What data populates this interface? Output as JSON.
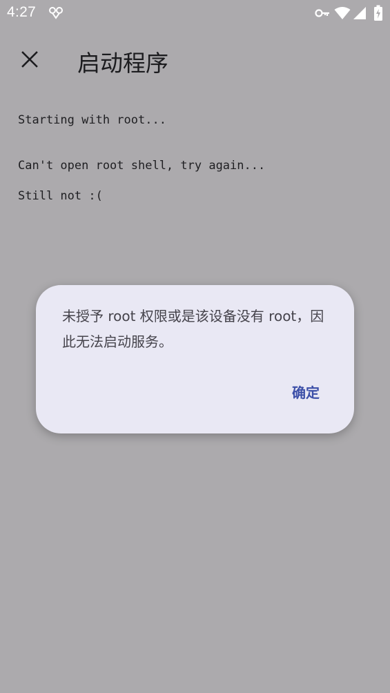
{
  "status_bar": {
    "time": "4:27"
  },
  "toolbar": {
    "title": "启动程序"
  },
  "log": {
    "lines": [
      "Starting with root...",
      "Can't open root shell, try again...",
      "Still not :("
    ]
  },
  "dialog": {
    "message": "未授予 root 权限或是该设备没有 root，因此无法启动服务。",
    "confirm_label": "确定"
  },
  "colors": {
    "scrim_background": "#acaaad",
    "dialog_background": "#e9e8f4",
    "accent": "#3c4fa8"
  }
}
